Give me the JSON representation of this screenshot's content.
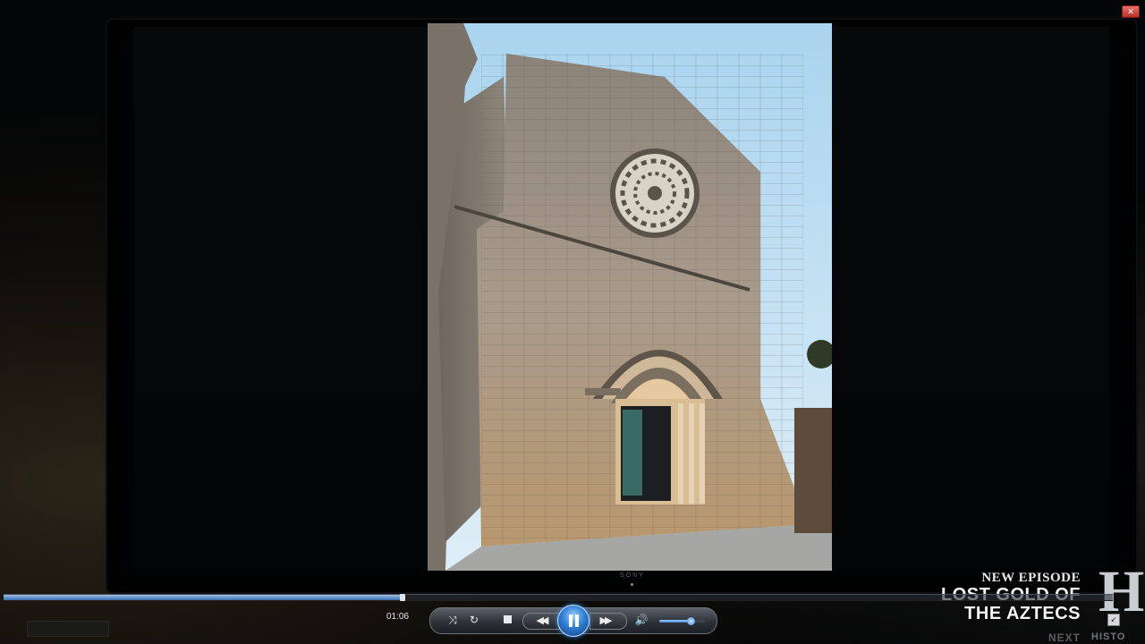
{
  "window": {
    "close_glyph": "✕"
  },
  "tv": {
    "brand": "SONY"
  },
  "photo": {
    "subject": "church-facade-icon"
  },
  "promo": {
    "kicker": "NEW EPISODE",
    "title_line1": "LOST GOLD OF",
    "title_line2": "THE AZTECS",
    "next_label": "NEXT",
    "logo_letter": "H",
    "logo_sub": "HISTO"
  },
  "player": {
    "elapsed": "01:06",
    "progress": 0.36,
    "volume": 0.68,
    "state": "playing",
    "accent": "#2f7fd4"
  },
  "icons": {
    "shuffle": "shuffle-icon",
    "repeat": "repeat-icon",
    "stop": "stop-icon",
    "previous": "previous-icon",
    "pause": "pause-icon",
    "next": "next-icon",
    "volume": "volume-icon"
  }
}
